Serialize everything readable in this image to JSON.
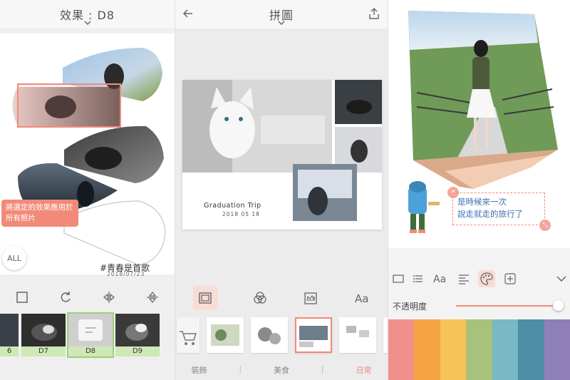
{
  "panel1": {
    "title": "效果 : D8",
    "tooltip": "將選定的效果應用於所有照片",
    "all_label": "ALL",
    "caption": "#青春是首歌",
    "date": "2018/07/23",
    "filters": [
      {
        "label": "6"
      },
      {
        "label": "D7"
      },
      {
        "label": "D8"
      },
      {
        "label": "D9"
      }
    ]
  },
  "panel2": {
    "title": "拼圖",
    "caption": "Graduation Trip",
    "date": "2018 05 18",
    "categories": [
      "裝飾",
      "美食",
      "日常"
    ]
  },
  "panel3": {
    "text_line1": "是時候來一次",
    "text_line2": "說走就走的旅行了",
    "opacity_label": "不透明度",
    "swatch_colors": [
      "#f1908a",
      "#f5a443",
      "#f6c35b",
      "#a7c27a",
      "#7ab8c4",
      "#4e8ea7",
      "#8f7fb8"
    ]
  }
}
